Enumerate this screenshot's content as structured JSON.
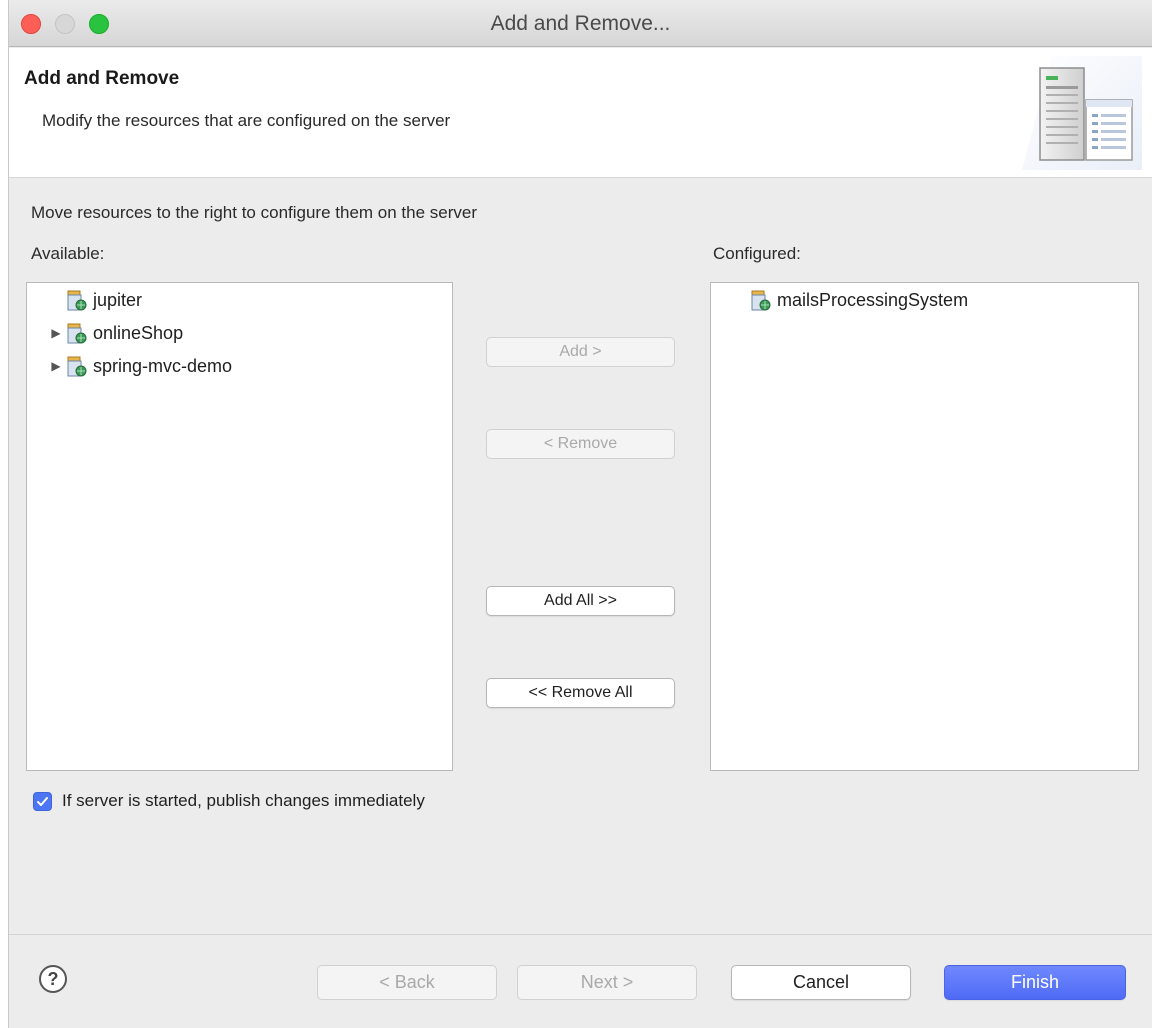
{
  "window": {
    "title": "Add and Remove..."
  },
  "header": {
    "title": "Add and Remove",
    "description": "Modify the resources that are configured on the server",
    "banner_icon": "server-banner-icon"
  },
  "body": {
    "instruction": "Move resources to the right to configure them on the server",
    "available_label": "Available:",
    "configured_label": "Configured:",
    "available_items": [
      {
        "label": "jupiter",
        "expandable": false
      },
      {
        "label": "onlineShop",
        "expandable": true
      },
      {
        "label": "spring-mvc-demo",
        "expandable": true
      }
    ],
    "configured_items": [
      {
        "label": "mailsProcessingSystem",
        "expandable": false
      }
    ]
  },
  "buttons": {
    "add": "Add >",
    "remove": "< Remove",
    "add_all": "Add All >>",
    "remove_all": "<< Remove All",
    "back": "< Back",
    "next": "Next >",
    "cancel": "Cancel",
    "finish": "Finish"
  },
  "publish_checkbox": {
    "label": "If server is started, publish changes immediately",
    "checked": true
  },
  "colors": {
    "accent": "#4f6bf5",
    "close": "#fd5f57",
    "maximize": "#29c33f"
  }
}
